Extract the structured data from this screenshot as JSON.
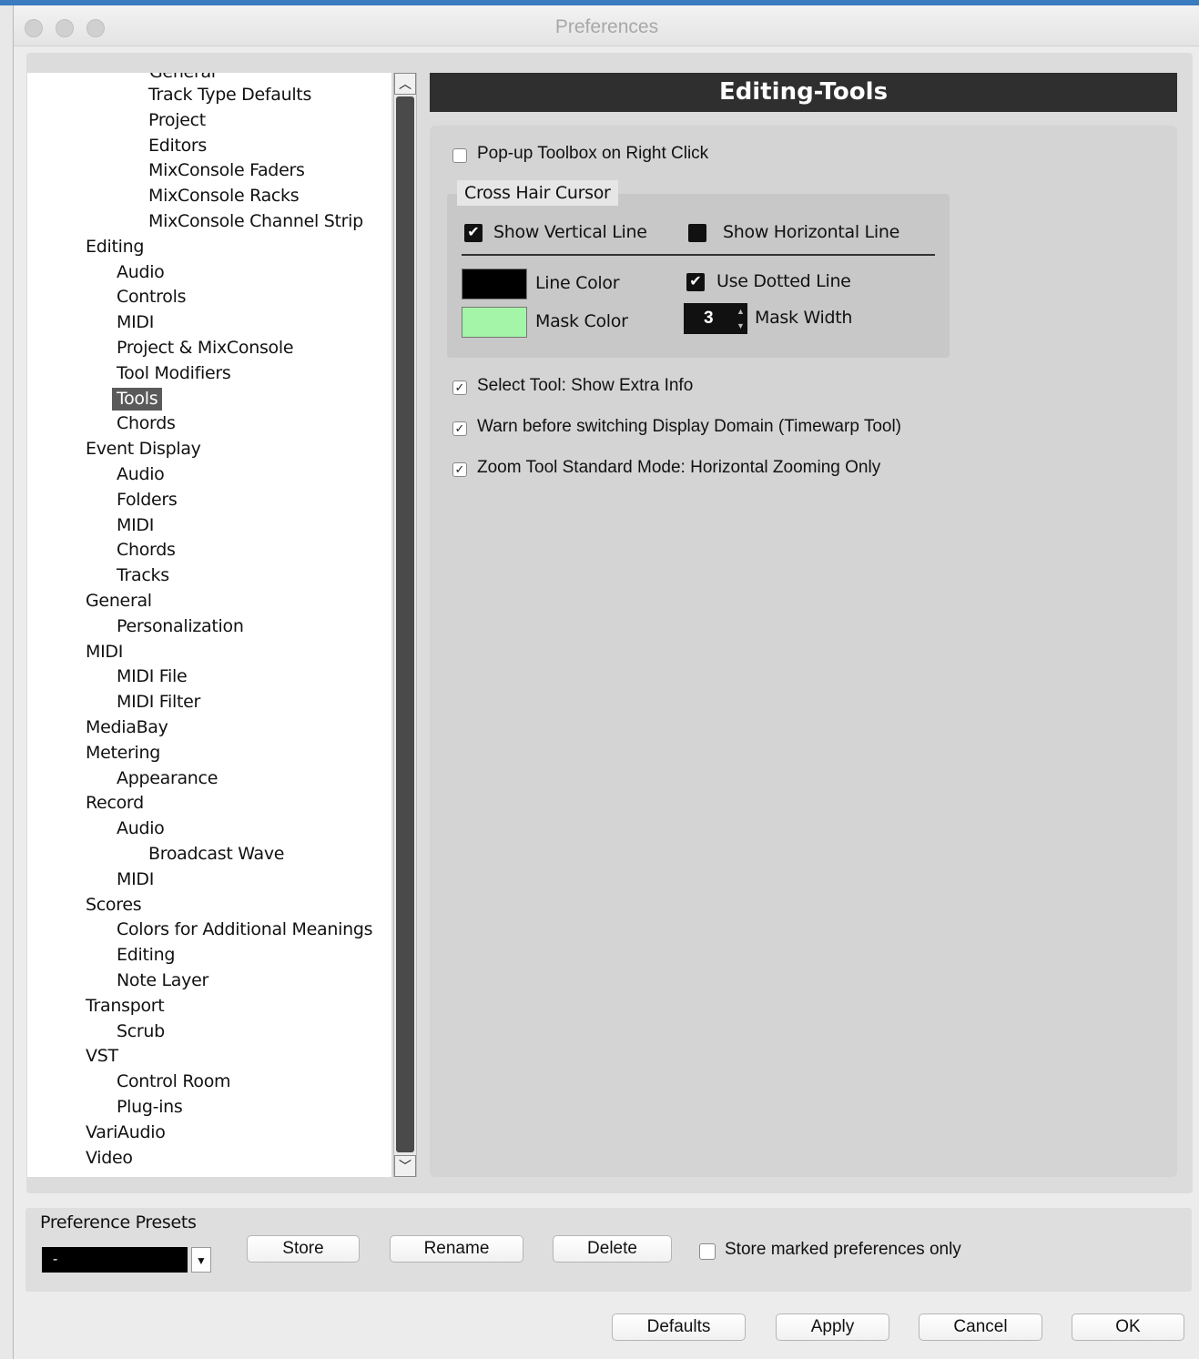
{
  "window": {
    "title": "Preferences"
  },
  "tree": {
    "partial_top": "General",
    "items": [
      {
        "label": "Track Type Defaults",
        "level": 2
      },
      {
        "label": "Project",
        "level": 2
      },
      {
        "label": "Editors",
        "level": 2
      },
      {
        "label": "MixConsole Faders",
        "level": 2
      },
      {
        "label": "MixConsole Racks",
        "level": 2
      },
      {
        "label": "MixConsole Channel Strip",
        "level": 2
      },
      {
        "label": "Editing",
        "level": 0
      },
      {
        "label": "Audio",
        "level": 1
      },
      {
        "label": "Controls",
        "level": 1
      },
      {
        "label": "MIDI",
        "level": 1
      },
      {
        "label": "Project & MixConsole",
        "level": 1
      },
      {
        "label": "Tool Modifiers",
        "level": 1
      },
      {
        "label": "Tools",
        "level": 1,
        "selected": true
      },
      {
        "label": "Chords",
        "level": 1
      },
      {
        "label": "Event Display",
        "level": 0
      },
      {
        "label": "Audio",
        "level": 1
      },
      {
        "label": "Folders",
        "level": 1
      },
      {
        "label": "MIDI",
        "level": 1
      },
      {
        "label": "Chords",
        "level": 1
      },
      {
        "label": "Tracks",
        "level": 1
      },
      {
        "label": "General",
        "level": 0
      },
      {
        "label": "Personalization",
        "level": 1
      },
      {
        "label": "MIDI",
        "level": 0
      },
      {
        "label": "MIDI File",
        "level": 1
      },
      {
        "label": "MIDI Filter",
        "level": 1
      },
      {
        "label": "MediaBay",
        "level": 0
      },
      {
        "label": "Metering",
        "level": 0
      },
      {
        "label": "Appearance",
        "level": 1
      },
      {
        "label": "Record",
        "level": 0
      },
      {
        "label": "Audio",
        "level": 1
      },
      {
        "label": "Broadcast Wave",
        "level": 2
      },
      {
        "label": "MIDI",
        "level": 1
      },
      {
        "label": "Scores",
        "level": 0
      },
      {
        "label": "Colors for Additional Meanings",
        "level": 1
      },
      {
        "label": "Editing",
        "level": 1
      },
      {
        "label": "Note Layer",
        "level": 1
      },
      {
        "label": "Transport",
        "level": 0
      },
      {
        "label": "Scrub",
        "level": 1
      },
      {
        "label": "VST",
        "level": 0
      },
      {
        "label": "Control Room",
        "level": 1
      },
      {
        "label": "Plug-ins",
        "level": 1
      },
      {
        "label": "VariAudio",
        "level": 0
      },
      {
        "label": "Video",
        "level": 0
      }
    ]
  },
  "page": {
    "header": "Editing-Tools",
    "popup_toolbox": {
      "label": "Pop-up Toolbox on Right Click",
      "checked": false
    },
    "cross_hair": {
      "title": "Cross Hair Cursor",
      "show_vertical": {
        "label": "Show Vertical Line",
        "checked": true
      },
      "show_horizontal": {
        "label": "Show Horizontal Line",
        "checked": false
      },
      "line_color": {
        "label": "Line Color",
        "color": "#000000"
      },
      "mask_color": {
        "label": "Mask Color",
        "color": "#a4f5a8"
      },
      "use_dotted": {
        "label": "Use Dotted Line",
        "checked": true
      },
      "mask_width": {
        "label": "Mask Width",
        "value": "3"
      }
    },
    "options": [
      {
        "label": "Select Tool: Show Extra Info",
        "checked": true
      },
      {
        "label": "Warn before switching Display Domain (Timewarp Tool)",
        "checked": true
      },
      {
        "label": "Zoom Tool Standard Mode: Horizontal Zooming Only",
        "checked": true
      }
    ]
  },
  "presets": {
    "title": "Preference Presets",
    "selected": "-",
    "store": "Store",
    "rename": "Rename",
    "delete": "Delete",
    "store_marked": {
      "label": "Store marked preferences only",
      "checked": false
    }
  },
  "footer": {
    "defaults": "Defaults",
    "apply": "Apply",
    "cancel": "Cancel",
    "ok": "OK"
  },
  "icons": {
    "scroll_up": "chevron-up-icon",
    "scroll_down": "chevron-down-icon",
    "checkmark": "checkmark-icon",
    "dropdown": "dropdown-arrow-icon"
  }
}
